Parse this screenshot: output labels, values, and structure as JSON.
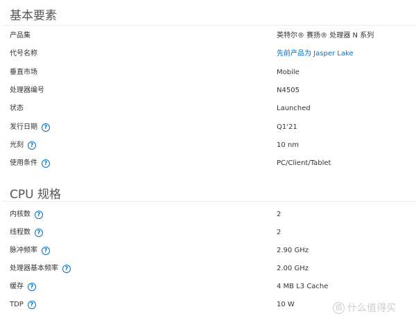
{
  "sections": [
    {
      "title": "基本要素",
      "rows": [
        {
          "label": "产品集",
          "value": "英特尔® 赛扬® 处理器 N 系列",
          "help": false
        },
        {
          "label": "代号名称",
          "value": "先前产品为 Jasper Lake",
          "help": false,
          "link": true
        },
        {
          "label": "垂直市场",
          "value": "Mobile",
          "help": false
        },
        {
          "label": "处理器编号",
          "value": "N4505",
          "help": false
        },
        {
          "label": "状态",
          "value": "Launched",
          "help": false
        },
        {
          "label": "发行日期",
          "value": "Q1'21",
          "help": true
        },
        {
          "label": "光刻",
          "value": "10 nm",
          "help": true
        },
        {
          "label": "使用条件",
          "value": "PC/Client/Tablet",
          "help": true
        }
      ]
    },
    {
      "title": "CPU 规格",
      "rows": [
        {
          "label": "内核数",
          "value": "2",
          "help": true
        },
        {
          "label": "线程数",
          "value": "2",
          "help": true
        },
        {
          "label": "脉冲频率",
          "value": "2.90 GHz",
          "help": true
        },
        {
          "label": "处理器基本频率",
          "value": "2.00 GHz",
          "help": true
        },
        {
          "label": "缓存",
          "value": "4 MB L3 Cache",
          "help": true
        },
        {
          "label": "TDP",
          "value": "10 W",
          "help": true
        }
      ]
    }
  ],
  "help_glyph": "?",
  "watermark": {
    "badge": "值",
    "text": "什么值得买"
  }
}
